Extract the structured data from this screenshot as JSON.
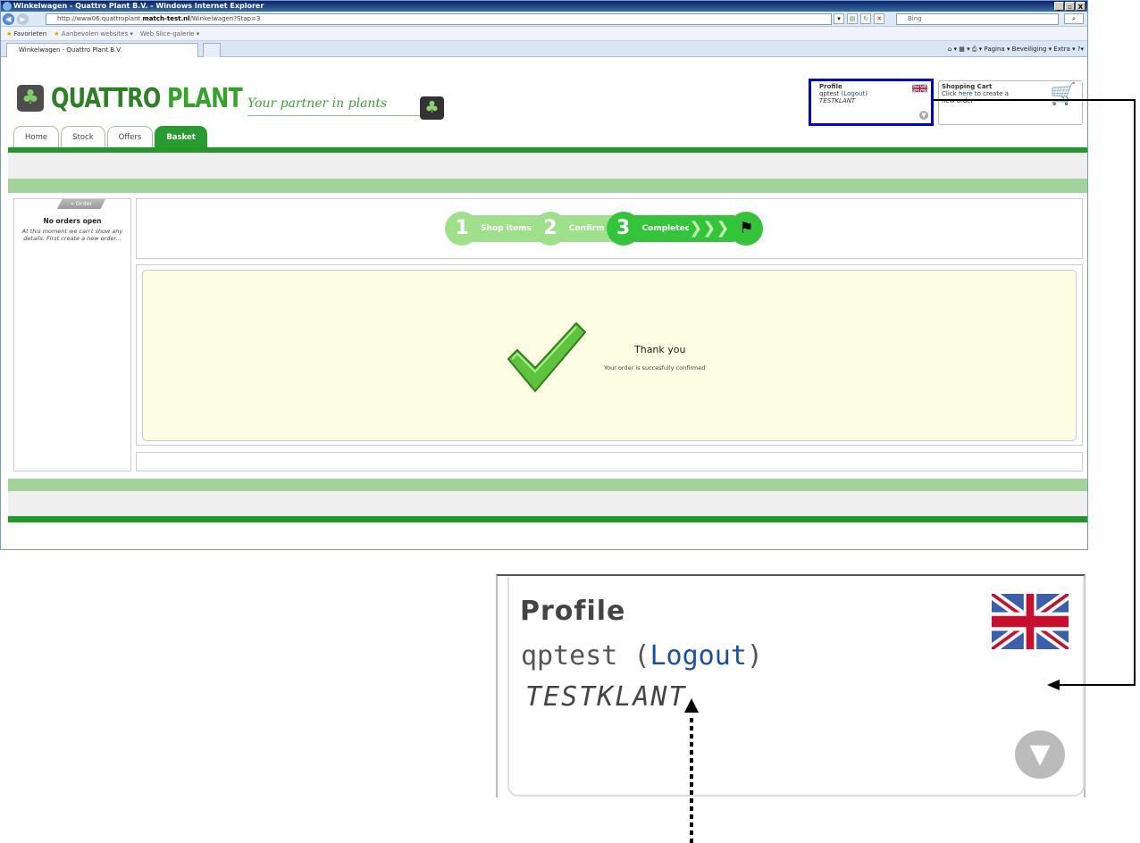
{
  "window": {
    "title": "Winkelwagen - Quattro Plant B.V. - Windows Internet Explorer",
    "controls": [
      "_",
      "▫",
      "X"
    ]
  },
  "address": {
    "url_pre": "http://www06.quattroplant.",
    "url_bold": "match-test.nl",
    "url_post": "/Winkelwagen?Stap=3",
    "search_placeholder": "Bing"
  },
  "favorites": {
    "label": "Favorieten",
    "items": [
      "Aanbevolen websites ▾",
      "Web Slice-galerie ▾"
    ]
  },
  "tab": {
    "title": "Winkelwagen - Quattro Plant B.V."
  },
  "command_bar": "Pagina ▾  Beveiliging ▾  Extra ▾",
  "logo": {
    "word1": "QUATTRO",
    "word2": "PLANT"
  },
  "tagline": "Your partner in plants",
  "nav": [
    "Home",
    "Stock",
    "Offers",
    "Basket"
  ],
  "profile": {
    "title": "Profile",
    "user": "qptest",
    "open": " (",
    "logout": "Logout",
    "close": ")",
    "customer": "TESTKLANT"
  },
  "cart": {
    "title": "Shopping Cart",
    "line1_pre": "Click ",
    "line1_link": "here",
    "line1_post": " to create a",
    "line2": "new order"
  },
  "sidebar": {
    "tab": "Order",
    "heading": "No orders open",
    "text": "At this moment we can't show any details. First create a new order..."
  },
  "steps": [
    {
      "num": "1",
      "label": "Shop items"
    },
    {
      "num": "2",
      "label": "Confirm"
    },
    {
      "num": "3",
      "label": "Completed"
    }
  ],
  "result": {
    "title": "Thank you",
    "message": "Your order is succesfully confirmed"
  },
  "colors": {
    "brand_green": "#1f9a26",
    "step_active": "#34c43a",
    "step_done": "#9fe08b",
    "highlight": "#0000e0"
  }
}
